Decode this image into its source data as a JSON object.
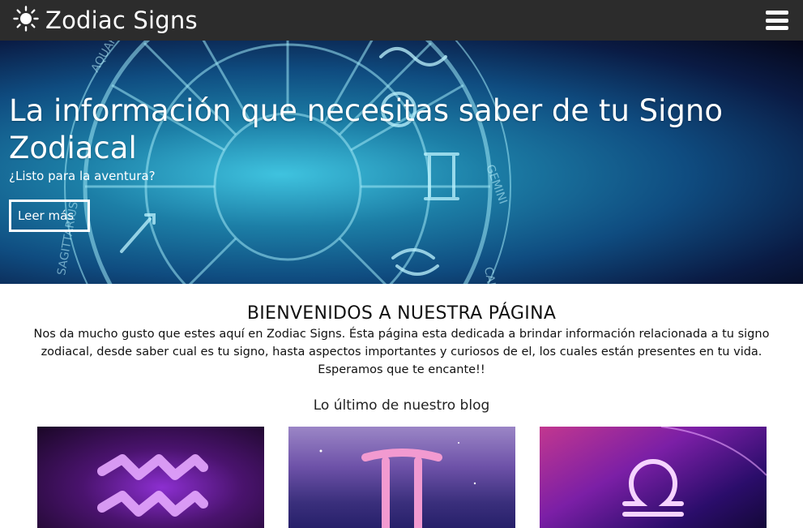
{
  "navbar": {
    "brand_text": "Zodiac Signs",
    "brand_icon": "sun-icon",
    "menu_icon": "hamburger-menu-icon"
  },
  "hero": {
    "title": "La información que necesitas saber de tu Signo Zodiacal",
    "subtitle": "¿Listo para la aventura?",
    "button_label": "Leer más"
  },
  "welcome": {
    "title": "BIENVENIDOS A NUESTRA PÁGINA",
    "text": "Nos da mucho gusto que estes aquí en Zodiac Signs. Ésta página esta dedicada a brindar información relacionada a tu signo zodiacal, desde saber cual es tu signo, hasta aspectos importantes y curiosos de el, los cuales están presentes en tu vida. Esperamos que te encante!!"
  },
  "blog": {
    "title": "Lo último de nuestro blog",
    "cards": [
      {
        "icon": "aquarius-icon"
      },
      {
        "icon": "gemini-icon"
      },
      {
        "icon": "libra-icon"
      }
    ]
  },
  "colors": {
    "navbar_bg": "#2c2c2c",
    "hero_accent": "#3fc3df",
    "text": "#111111"
  }
}
